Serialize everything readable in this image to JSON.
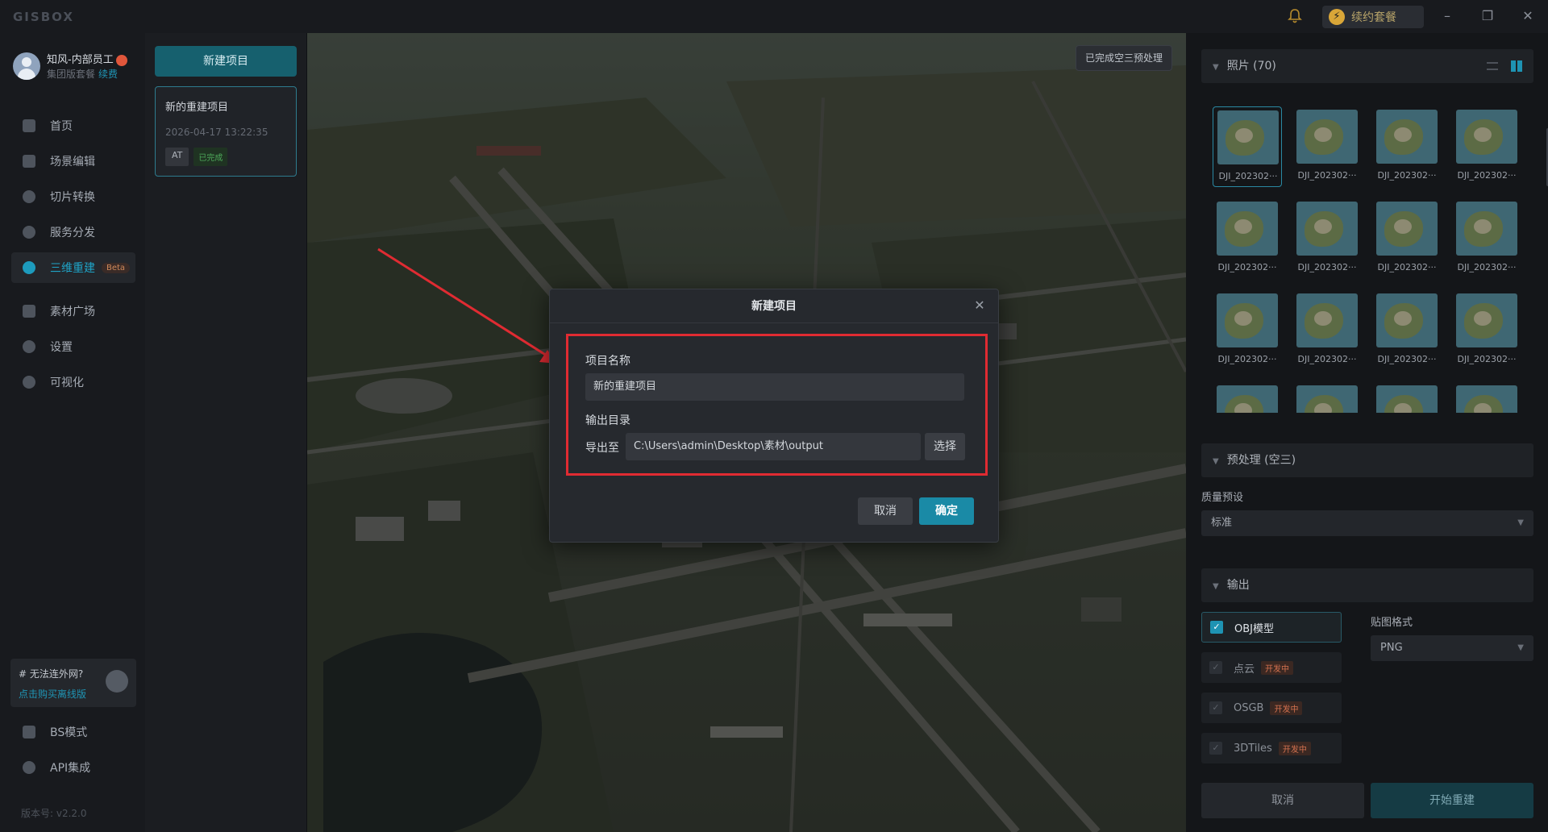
{
  "app": {
    "logo": "GISBOX",
    "renew_label": "续约套餐"
  },
  "user": {
    "name": "知风-内部员工",
    "plan": "集团版套餐",
    "renew_link": "续费"
  },
  "nav": {
    "items": [
      {
        "label": "首页"
      },
      {
        "label": "场景编辑"
      },
      {
        "label": "切片转换"
      },
      {
        "label": "服务分发"
      },
      {
        "label": "三维重建",
        "badge": "Beta",
        "active": true
      },
      {
        "label": "素材广场"
      },
      {
        "label": "设置"
      },
      {
        "label": "可视化"
      }
    ],
    "offline": {
      "title": "# 无法连外网?",
      "link": "点击购买离线版"
    },
    "bottom": [
      {
        "label": "BS模式"
      },
      {
        "label": "API集成"
      }
    ],
    "version": "版本号: v2.2.0"
  },
  "projects": {
    "new_button": "新建项目",
    "list": [
      {
        "name": "新的重建项目",
        "date": "2026-04-17 13:22:35",
        "tag": "AT",
        "status": "已完成"
      }
    ]
  },
  "viewport": {
    "status_chip": "已完成空三预处理"
  },
  "right": {
    "photos_title": "照片 (70)",
    "photos": [
      "DJI_202302···",
      "DJI_202302···",
      "DJI_202302···",
      "DJI_202302···",
      "DJI_202302···",
      "DJI_202302···",
      "DJI_202302···",
      "DJI_202302···",
      "DJI_202302···",
      "DJI_202302···",
      "DJI_202302···",
      "DJI_202302···",
      "",
      "",
      "",
      ""
    ],
    "preprocess_title": "预处理 (空三)",
    "quality_label": "质量预设",
    "quality_value": "标准",
    "output_title": "输出",
    "texture_label": "贴图格式",
    "texture_value": "PNG",
    "outputs": [
      {
        "label": "OBJ模型",
        "checked": true,
        "dev": ""
      },
      {
        "label": "点云",
        "checked": false,
        "dev": "开发中"
      },
      {
        "label": "OSGB",
        "checked": false,
        "dev": "开发中"
      },
      {
        "label": "3DTiles",
        "checked": false,
        "dev": "开发中"
      }
    ],
    "cancel": "取消",
    "start": "开始重建"
  },
  "modal": {
    "title": "新建项目",
    "name_label": "项目名称",
    "name_value": "新的重建项目",
    "output_label": "输出目录",
    "export_label": "导出至",
    "path_value": "C:\\Users\\admin\\Desktop\\素材\\output",
    "choose": "选择",
    "cancel": "取消",
    "confirm": "确定"
  },
  "colors": {
    "accent": "#1e93b3",
    "highlight": "#e02b32",
    "dev_badge": "#d3714f"
  }
}
